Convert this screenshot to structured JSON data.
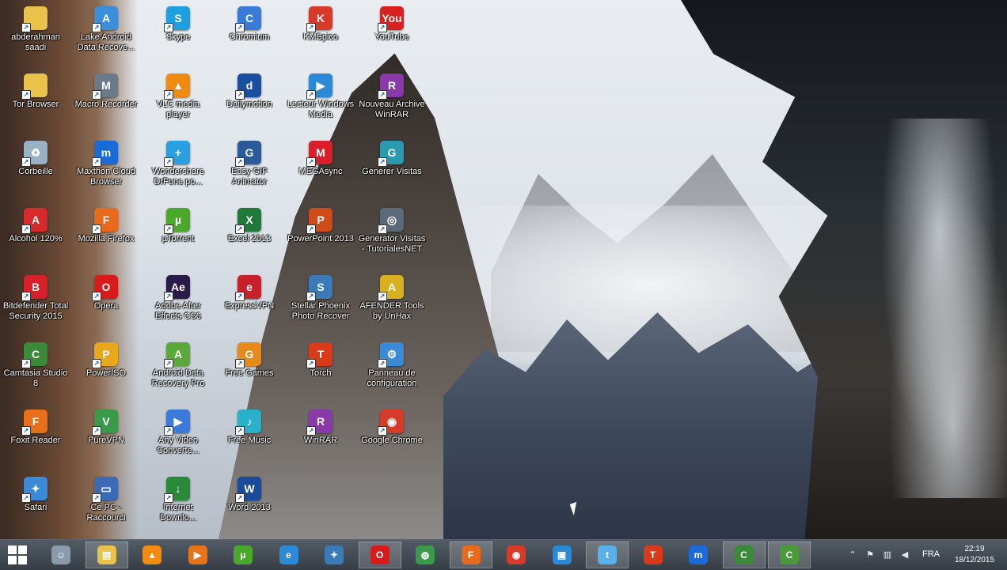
{
  "desktop": {
    "icons": [
      {
        "label": "abderahman saadi",
        "icon": "folder-icon",
        "color": "#e8c24a",
        "glyph": ""
      },
      {
        "label": "Lake Android Data Recove...",
        "icon": "recovery-icon",
        "color": "#3a8fd8",
        "glyph": "A"
      },
      {
        "label": "Skype",
        "icon": "skype-icon",
        "color": "#1ea0e0",
        "glyph": "S"
      },
      {
        "label": "Chromium",
        "icon": "chromium-icon",
        "color": "#3b7bd8",
        "glyph": "C"
      },
      {
        "label": "KMSpico",
        "icon": "kmspico-icon",
        "color": "#d83a2a",
        "glyph": "K"
      },
      {
        "label": "YouTube",
        "icon": "youtube-icon",
        "color": "#d82020",
        "glyph": "You"
      },
      {
        "label": "Tor Browser",
        "icon": "folder-icon",
        "color": "#e8c24a",
        "glyph": ""
      },
      {
        "label": "Macro Recorder",
        "icon": "macro-recorder-icon",
        "color": "#6a7a8a",
        "glyph": "M"
      },
      {
        "label": "VLC media player",
        "icon": "vlc-icon",
        "color": "#f08a10",
        "glyph": "▲"
      },
      {
        "label": "Dailymotion",
        "icon": "dailymotion-icon",
        "color": "#1a4fa0",
        "glyph": "d"
      },
      {
        "label": "Lecteur Windows Media",
        "icon": "media-player-icon",
        "color": "#2a8ad8",
        "glyph": "▶"
      },
      {
        "label": "Nouveau Archive WinRAR",
        "icon": "winrar-archive-icon",
        "color": "#8a3aa8",
        "glyph": "R"
      },
      {
        "label": "Corbeille",
        "icon": "recycle-bin-icon",
        "color": "#9ab0c4",
        "glyph": "♻"
      },
      {
        "label": "Maxthon Cloud Browser",
        "icon": "maxthon-icon",
        "color": "#1a6ad8",
        "glyph": "m"
      },
      {
        "label": "Wondershare DrFone po...",
        "icon": "drfone-icon",
        "color": "#2aa0e0",
        "glyph": "+"
      },
      {
        "label": "Easy GIF Animator",
        "icon": "gif-animator-icon",
        "color": "#2a5a9a",
        "glyph": "G"
      },
      {
        "label": "MEGAsync",
        "icon": "megasync-icon",
        "color": "#d8202a",
        "glyph": "M"
      },
      {
        "label": "Generer Visitas",
        "icon": "generator-icon",
        "color": "#2a9ab0",
        "glyph": "G"
      },
      {
        "label": "Alcohol 120%",
        "icon": "alcohol-icon",
        "color": "#d82a2a",
        "glyph": "A"
      },
      {
        "label": "Mozilla Firefox",
        "icon": "firefox-icon",
        "color": "#e86a1a",
        "glyph": "F"
      },
      {
        "label": "µTorrent",
        "icon": "utorrent-icon",
        "color": "#4aa82a",
        "glyph": "µ"
      },
      {
        "label": "Excel 2013",
        "icon": "excel-icon",
        "color": "#1f7a3a",
        "glyph": "X"
      },
      {
        "label": "PowerPoint 2013",
        "icon": "powerpoint-icon",
        "color": "#d04a1a",
        "glyph": "P"
      },
      {
        "label": "Generator Visitas - TutorialesNET",
        "icon": "generator-visitas-icon",
        "color": "#5a6a7a",
        "glyph": "◎"
      },
      {
        "label": "Bitdefender Total Security 2015",
        "icon": "bitdefender-icon",
        "color": "#d8202a",
        "glyph": "B"
      },
      {
        "label": "Opera",
        "icon": "opera-icon",
        "color": "#d81a1a",
        "glyph": "O"
      },
      {
        "label": "Adobe After Effects CS6",
        "icon": "after-effects-icon",
        "color": "#2a1a4a",
        "glyph": "Ae"
      },
      {
        "label": "ExpressVPN",
        "icon": "expressvpn-icon",
        "color": "#c8202a",
        "glyph": "e"
      },
      {
        "label": "Stellar Phoenix Photo Recover",
        "icon": "stellar-icon",
        "color": "#3a7ab8",
        "glyph": "S"
      },
      {
        "label": "AFENDER Tools by UnHax",
        "icon": "afender-icon",
        "color": "#d8b020",
        "glyph": "A"
      },
      {
        "label": "Camtasia Studio 8",
        "icon": "camtasia-icon",
        "color": "#3a8a3a",
        "glyph": "C"
      },
      {
        "label": "PowerISO",
        "icon": "poweriso-icon",
        "color": "#e8a81a",
        "glyph": "P"
      },
      {
        "label": "Android Data Recovery Pro",
        "icon": "android-recovery-icon",
        "color": "#5aa83a",
        "glyph": "A"
      },
      {
        "label": "Free Games",
        "icon": "free-games-icon",
        "color": "#e88a1a",
        "glyph": "G"
      },
      {
        "label": "Torch",
        "icon": "torch-icon",
        "color": "#d83a1a",
        "glyph": "T"
      },
      {
        "label": "Panneau de configuration",
        "icon": "control-panel-icon",
        "color": "#3a8ad8",
        "glyph": "⚙"
      },
      {
        "label": "Foxit Reader",
        "icon": "foxit-icon",
        "color": "#e8701a",
        "glyph": "F"
      },
      {
        "label": "PureVPN",
        "icon": "purevpn-icon",
        "color": "#3a9a4a",
        "glyph": "V"
      },
      {
        "label": "Any Video Converte...",
        "icon": "video-converter-icon",
        "color": "#3a7ad8",
        "glyph": "▶"
      },
      {
        "label": "Free Music",
        "icon": "free-music-icon",
        "color": "#2ab0c8",
        "glyph": "♪"
      },
      {
        "label": "WinRAR",
        "icon": "winrar-icon",
        "color": "#8a3aa8",
        "glyph": "R"
      },
      {
        "label": "Google Chrome",
        "icon": "chrome-icon",
        "color": "#d83a2a",
        "glyph": "◉"
      },
      {
        "label": "Safari",
        "icon": "safari-icon",
        "color": "#3a8ad8",
        "glyph": "✦"
      },
      {
        "label": "Ce PC - Raccourci",
        "icon": "this-pc-icon",
        "color": "#3a6ab8",
        "glyph": "▭"
      },
      {
        "label": "Internet Downlo...",
        "icon": "idm-icon",
        "color": "#2a8a3a",
        "glyph": "↓"
      },
      {
        "label": "Word 2013",
        "icon": "word-icon",
        "color": "#1a4a9a",
        "glyph": "W"
      }
    ]
  },
  "taskbar": {
    "start_label": "Start",
    "items": [
      {
        "icon": "network-user-icon",
        "color": "#8a9aaa",
        "glyph": "☺"
      },
      {
        "icon": "file-explorer-icon",
        "color": "#e8c24a",
        "glyph": "▤"
      },
      {
        "icon": "vlc-icon",
        "color": "#f08a10",
        "glyph": "▲"
      },
      {
        "icon": "media-player-icon",
        "color": "#e8741a",
        "glyph": "▶"
      },
      {
        "icon": "utorrent-icon",
        "color": "#4aa82a",
        "glyph": "µ"
      },
      {
        "icon": "internet-explorer-icon",
        "color": "#2a8ad8",
        "glyph": "e"
      },
      {
        "icon": "safari-icon",
        "color": "#3a7ab8",
        "glyph": "✦"
      },
      {
        "icon": "opera-icon",
        "color": "#d81a1a",
        "glyph": "O"
      },
      {
        "icon": "globe-icon",
        "color": "#3a9a4a",
        "glyph": "◍"
      },
      {
        "icon": "firefox-icon",
        "color": "#e86a1a",
        "glyph": "F"
      },
      {
        "icon": "chrome-icon",
        "color": "#d83a2a",
        "glyph": "◉"
      },
      {
        "icon": "phone-app-icon",
        "color": "#2a8ad8",
        "glyph": "▣"
      },
      {
        "icon": "twitter-icon",
        "color": "#5ab0e8",
        "glyph": "t"
      },
      {
        "icon": "torch-icon",
        "color": "#d83a1a",
        "glyph": "T"
      },
      {
        "icon": "maxthon-icon",
        "color": "#1a6ad8",
        "glyph": "m"
      },
      {
        "icon": "camtasia-recorder-icon",
        "color": "#3a8a3a",
        "glyph": "C"
      },
      {
        "icon": "camtasia-icon",
        "color": "#4a9a3a",
        "glyph": "C"
      }
    ],
    "tray": {
      "language": "FRA",
      "time": "22:19",
      "date": "18/12/2015"
    }
  }
}
